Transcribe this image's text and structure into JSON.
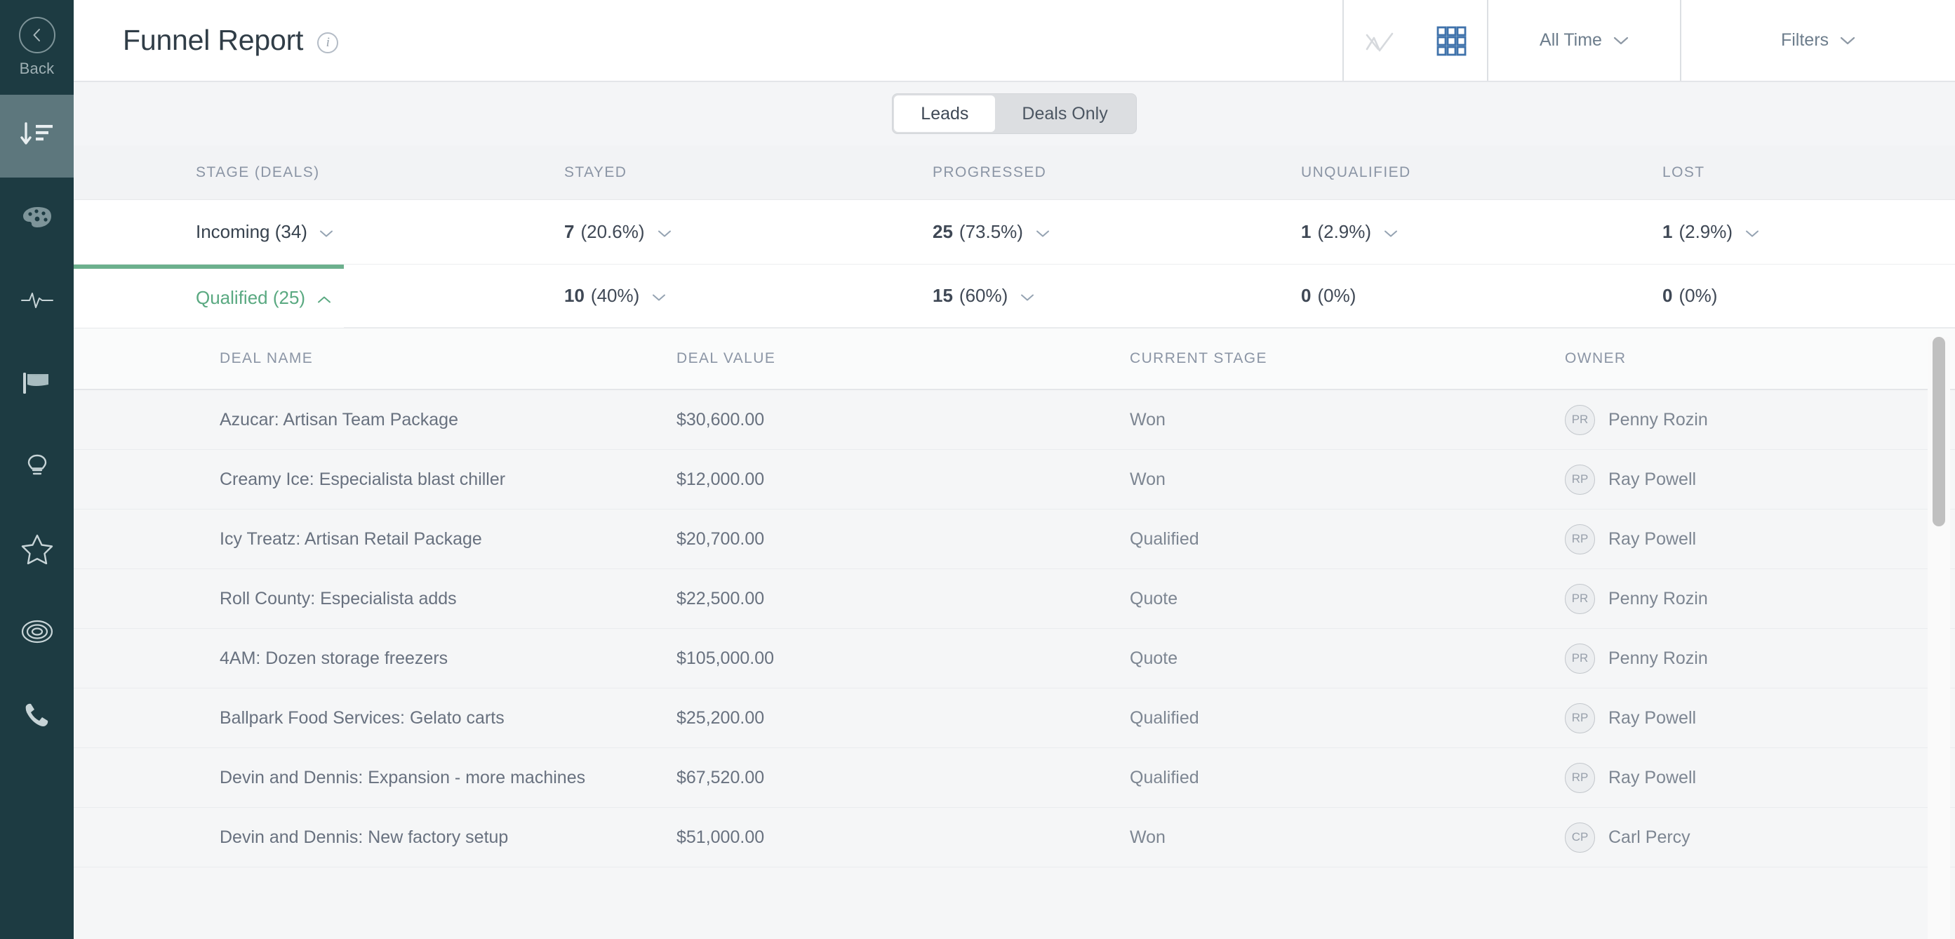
{
  "sidebar": {
    "back": {
      "label": "Back",
      "icon": "chevron-left-icon"
    },
    "items": [
      {
        "name": "funnel-report",
        "icon": "funnel-sort-icon",
        "active": true
      },
      {
        "name": "dashboard",
        "icon": "palette-icon",
        "active": false
      },
      {
        "name": "activity",
        "icon": "pulse-icon",
        "active": false
      },
      {
        "name": "goals",
        "icon": "flag-icon",
        "active": false
      },
      {
        "name": "insights",
        "icon": "lightbulb-icon",
        "active": false
      },
      {
        "name": "favorites",
        "icon": "star-icon",
        "active": false
      },
      {
        "name": "targets",
        "icon": "target-icon",
        "active": false
      },
      {
        "name": "calls",
        "icon": "phone-icon",
        "active": false
      }
    ]
  },
  "header": {
    "title": "Funnel Report",
    "info_icon": "info-icon",
    "chart_view_icon": "line-chart-icon",
    "grid_view_icon": "grid-view-icon",
    "date_range": "All Time",
    "filters": "Filters",
    "accent_active": "#3f72ab",
    "accent_inactive": "#d6d9dd"
  },
  "tabs": {
    "items": [
      {
        "label": "Leads",
        "selected": true
      },
      {
        "label": "Deals Only",
        "selected": false
      }
    ]
  },
  "funnel": {
    "columns": [
      "STAGE (DEALS)",
      "STAYED",
      "PROGRESSED",
      "UNQUALIFIED",
      "LOST"
    ],
    "accent_green": "#6cb08d",
    "rows": [
      {
        "stage": "Incoming (34)",
        "expanded": false,
        "selected": false,
        "stayed": {
          "count": "7",
          "pct": "(20.6%)",
          "expandable": true
        },
        "progressed": {
          "count": "25",
          "pct": "(73.5%)",
          "expandable": true
        },
        "unqualified": {
          "count": "1",
          "pct": "(2.9%)",
          "expandable": true
        },
        "lost": {
          "count": "1",
          "pct": "(2.9%)",
          "expandable": true
        }
      },
      {
        "stage": "Qualified (25)",
        "expanded": true,
        "selected": true,
        "stayed": {
          "count": "10",
          "pct": "(40%)",
          "expandable": true
        },
        "progressed": {
          "count": "15",
          "pct": "(60%)",
          "expandable": true
        },
        "unqualified": {
          "count": "0",
          "pct": "(0%)",
          "expandable": false
        },
        "lost": {
          "count": "0",
          "pct": "(0%)",
          "expandable": false
        }
      }
    ]
  },
  "deals": {
    "columns": [
      "DEAL NAME",
      "DEAL VALUE",
      "CURRENT STAGE",
      "OWNER"
    ],
    "rows": [
      {
        "name": "Azucar: Artisan Team Package",
        "value": "$30,600.00",
        "stage": "Won",
        "owner": "Penny Rozin",
        "initials": "PR"
      },
      {
        "name": "Creamy Ice: Especialista blast chiller",
        "value": "$12,000.00",
        "stage": "Won",
        "owner": "Ray Powell",
        "initials": "RP"
      },
      {
        "name": "Icy Treatz: Artisan Retail Package",
        "value": "$20,700.00",
        "stage": "Qualified",
        "owner": "Ray Powell",
        "initials": "RP"
      },
      {
        "name": "Roll County: Especialista adds",
        "value": "$22,500.00",
        "stage": "Quote",
        "owner": "Penny Rozin",
        "initials": "PR"
      },
      {
        "name": "4AM: Dozen storage freezers",
        "value": "$105,000.00",
        "stage": "Quote",
        "owner": "Penny Rozin",
        "initials": "PR"
      },
      {
        "name": "Ballpark Food Services: Gelato carts",
        "value": "$25,200.00",
        "stage": "Qualified",
        "owner": "Ray Powell",
        "initials": "RP"
      },
      {
        "name": "Devin and Dennis: Expansion - more machines",
        "value": "$67,520.00",
        "stage": "Qualified",
        "owner": "Ray Powell",
        "initials": "RP"
      },
      {
        "name": "Devin and Dennis: New factory setup",
        "value": "$51,000.00",
        "stage": "Won",
        "owner": "Carl Percy",
        "initials": "CP"
      }
    ]
  }
}
